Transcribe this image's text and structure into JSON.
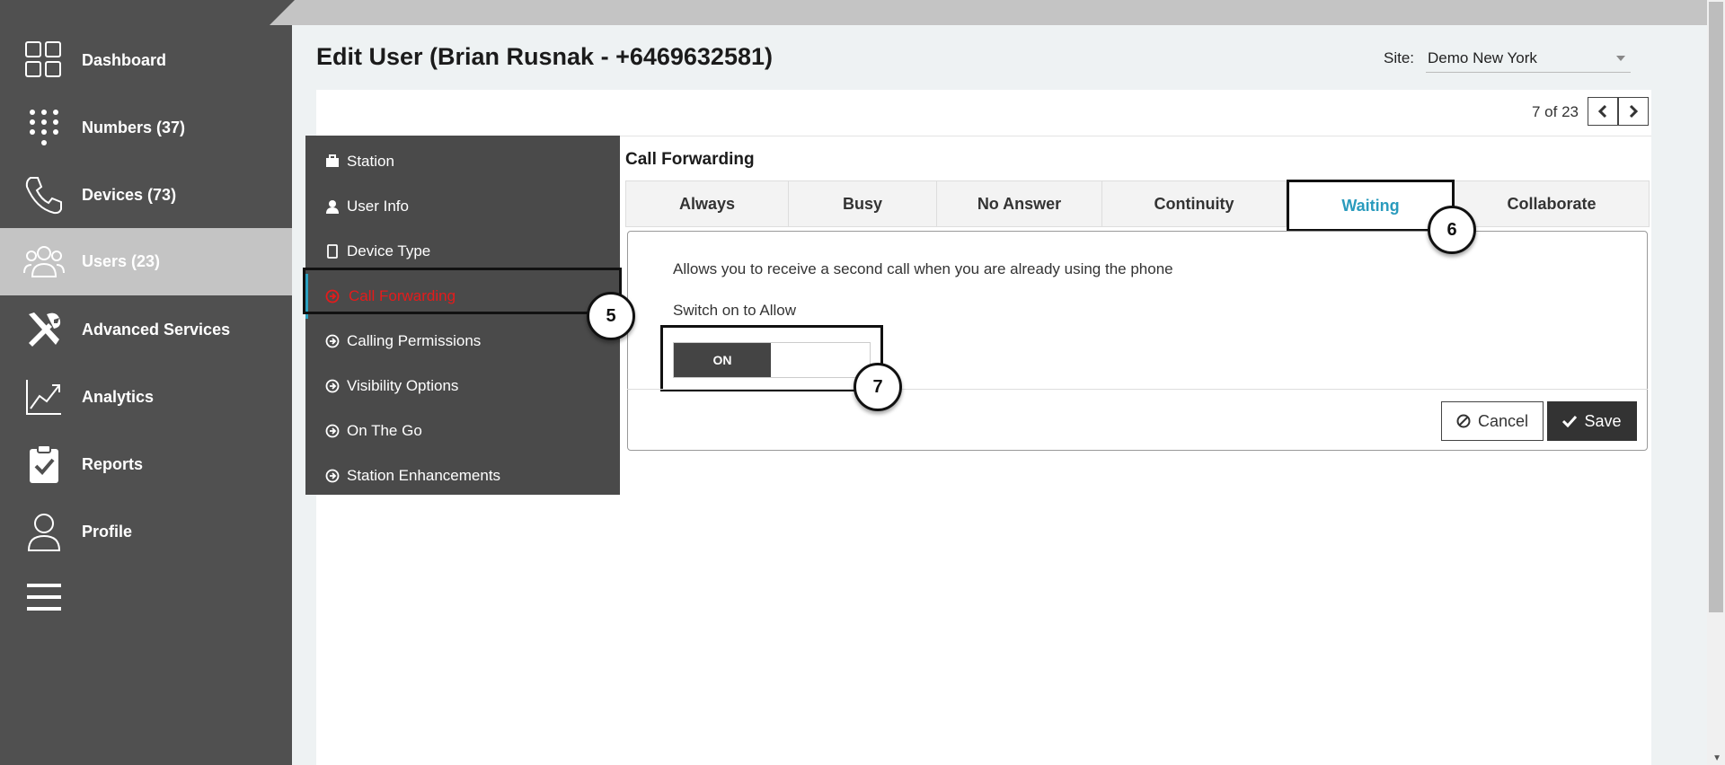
{
  "nav": {
    "items": [
      {
        "label": "Dashboard",
        "icon": "dashboard-grid-icon"
      },
      {
        "label": "Numbers (37)",
        "icon": "keypad-icon"
      },
      {
        "label": "Devices (73)",
        "icon": "phone-handset-icon"
      },
      {
        "label": "Users (23)",
        "icon": "users-group-icon",
        "active": true
      },
      {
        "label": "Advanced Services",
        "icon": "tools-icon"
      },
      {
        "label": "Analytics",
        "icon": "analytics-chart-icon"
      },
      {
        "label": "Reports",
        "icon": "clipboard-check-icon"
      },
      {
        "label": "Profile",
        "icon": "profile-user-icon"
      }
    ],
    "menu_icon": "hamburger-menu-icon"
  },
  "header": {
    "title": "Edit User (Brian Rusnak - +6469632581)",
    "site_label": "Site:",
    "site_value": "Demo New York"
  },
  "pager": {
    "text": "7 of 23"
  },
  "submenu": {
    "items": [
      {
        "label": "Station",
        "icon": "briefcase-icon"
      },
      {
        "label": "User Info",
        "icon": "user-icon"
      },
      {
        "label": "Device Type",
        "icon": "mobile-icon"
      },
      {
        "label": "Call Forwarding",
        "icon": "circle-arrow-icon",
        "active": true
      },
      {
        "label": "Calling Permissions",
        "icon": "circle-arrow-icon"
      },
      {
        "label": "Visibility Options",
        "icon": "circle-arrow-icon"
      },
      {
        "label": "On The Go",
        "icon": "circle-arrow-icon"
      },
      {
        "label": "Station Enhancements",
        "icon": "circle-arrow-icon"
      }
    ]
  },
  "call_forwarding": {
    "title": "Call Forwarding",
    "tabs": [
      "Always",
      "Busy",
      "No Answer",
      "Continuity",
      "Waiting",
      "Collaborate"
    ],
    "active_tab": "Waiting",
    "description": "Allows you to receive a second call when you are already using the phone",
    "switch_label": "Switch on to Allow",
    "toggle_state": "ON",
    "cancel_label": "Cancel",
    "save_label": "Save"
  },
  "callouts": [
    "5",
    "6",
    "7"
  ],
  "colors": {
    "nav_bg": "#505050",
    "active_nav_bg": "#c4c4c4",
    "active_tab_text": "#2a9bbd",
    "active_submenu_text": "#e41b1b",
    "save_bg": "#333333"
  }
}
